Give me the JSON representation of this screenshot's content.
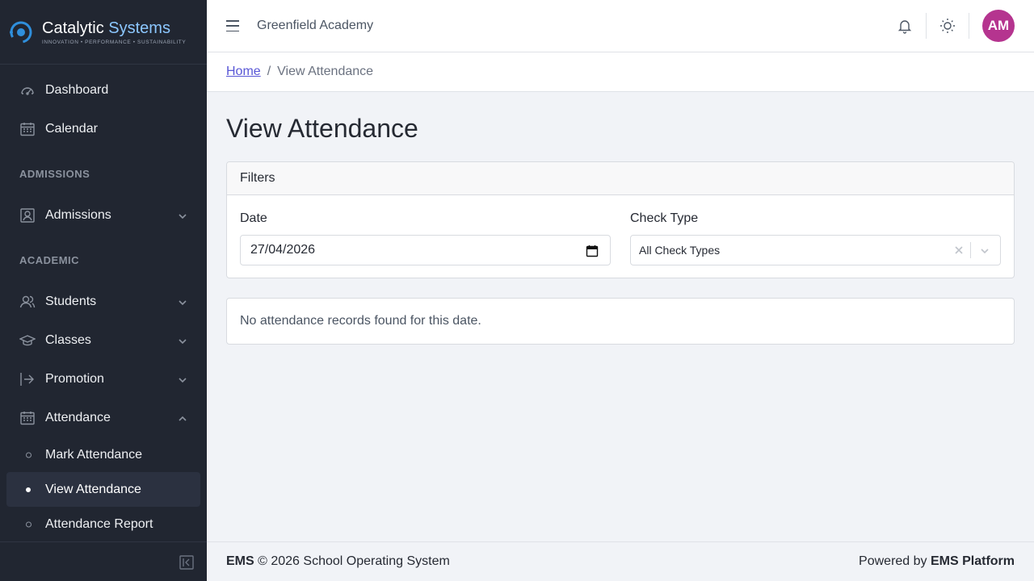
{
  "brand": {
    "name_part1": "Catalytic",
    "name_part2": "Systems",
    "tagline": "INNOVATION • PERFORMANCE • SUSTAINABILITY"
  },
  "sidebar": {
    "top_items": [
      {
        "label": "Dashboard",
        "icon": "speedometer-icon"
      },
      {
        "label": "Calendar",
        "icon": "calendar-icon"
      }
    ],
    "sections": [
      {
        "title": "ADMISSIONS",
        "items": [
          {
            "label": "Admissions",
            "icon": "id-card-icon",
            "expanded": false
          }
        ]
      },
      {
        "title": "ACADEMIC",
        "items": [
          {
            "label": "Students",
            "icon": "people-icon",
            "expanded": false
          },
          {
            "label": "Classes",
            "icon": "education-icon",
            "expanded": false
          },
          {
            "label": "Promotion",
            "icon": "arrow-enter-icon",
            "expanded": false
          },
          {
            "label": "Attendance",
            "icon": "calendar-icon",
            "expanded": true
          }
        ]
      }
    ],
    "attendance_sub": [
      {
        "label": "Mark Attendance",
        "active": false
      },
      {
        "label": "View Attendance",
        "active": true
      },
      {
        "label": "Attendance Report",
        "active": false
      }
    ]
  },
  "header": {
    "org_name": "Greenfield Academy",
    "avatar_initials": "AM",
    "avatar_color": "#b5348f"
  },
  "breadcrumb": {
    "home": "Home",
    "separator": "/",
    "current": "View Attendance"
  },
  "page": {
    "title": "View Attendance",
    "filters": {
      "header": "Filters",
      "date_label": "Date",
      "date_value": "27/04/2026",
      "check_type_label": "Check Type",
      "check_type_value": "All Check Types"
    },
    "empty_message": "No attendance records found for this date."
  },
  "footer": {
    "left_bold": "EMS",
    "left_text": " © 2026 School Operating System",
    "right_text": "Powered by ",
    "right_bold": "EMS Platform"
  },
  "colors": {
    "sidebar_bg": "#212631",
    "accent_link": "#5856d6"
  }
}
